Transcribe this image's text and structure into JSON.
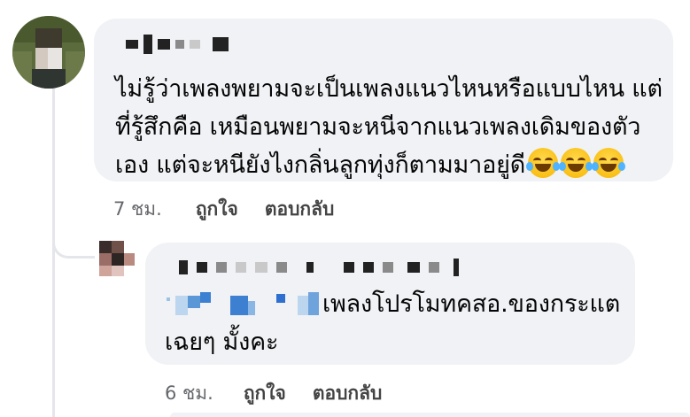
{
  "comments": [
    {
      "text_lines": [
        "ไม่รู้ว่าเพลงพยามจะเป็นเพลงแนวไหนหรือแบบไหน แต่",
        "ที่รู้สึกคือ เหมือนพยามจะหนีจากแนวเพลงเดิมของตัว",
        "เอง แต่จะหนียังไงกลิ่นลูกทุ่งก็ตามมาอยู่ดี"
      ],
      "emoji": "face-with-tears-of-joy-icon",
      "time": "7 ชม.",
      "like_label": "ถูกใจ",
      "reply_label": "ตอบกลับ"
    },
    {
      "text_lines": [
        "เพลงโปรโมทคสอ.ของกระแต",
        "เฉยๆ มั้งคะ"
      ],
      "time": "6 ชม.",
      "like_label": "ถูกใจ",
      "reply_label": "ตอบกลับ"
    }
  ],
  "colors": {
    "bubble_bg": "#f0f2f5",
    "thread_line": "#e4e6eb",
    "text": "#050505",
    "meta": "#65676b"
  }
}
